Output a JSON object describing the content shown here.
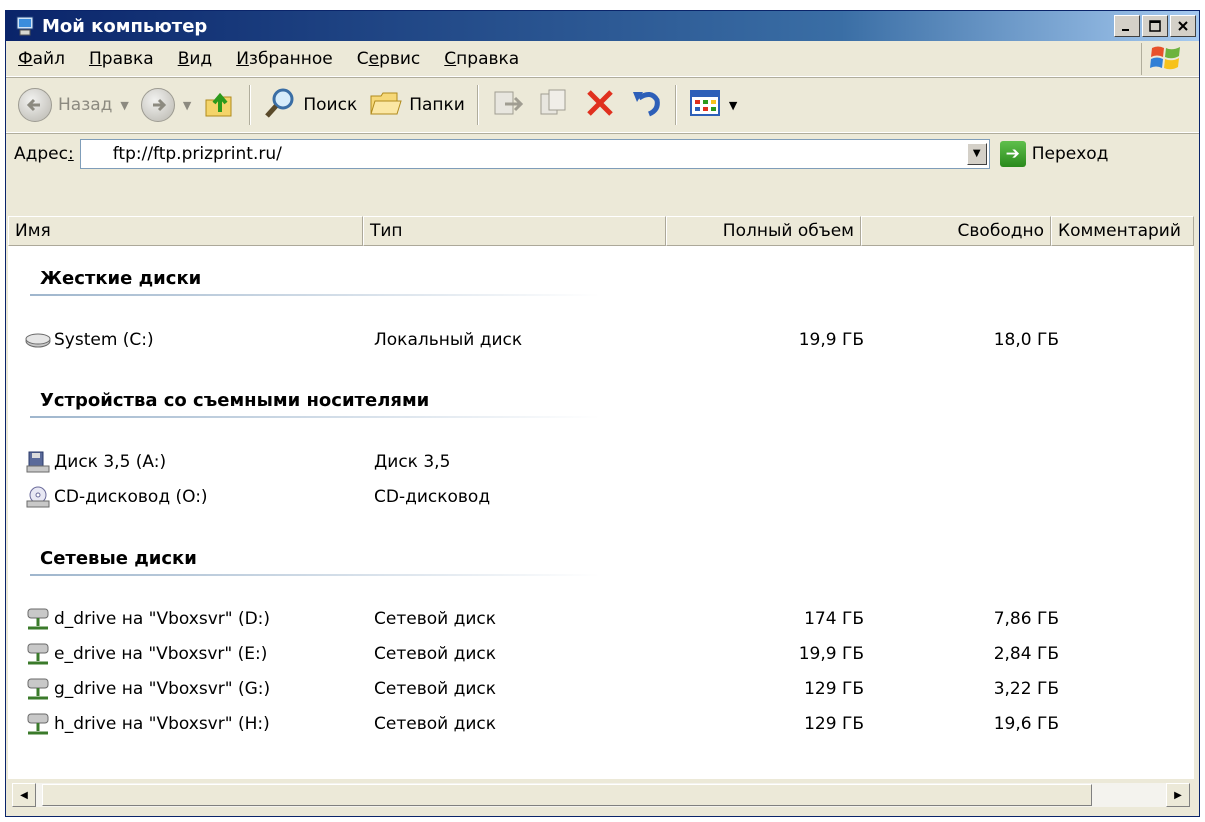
{
  "window": {
    "title": "Мой компьютер"
  },
  "menu": [
    {
      "pre": "",
      "u": "Ф",
      "post": "айл"
    },
    {
      "pre": "",
      "u": "П",
      "post": "равка"
    },
    {
      "pre": "",
      "u": "В",
      "post": "ид"
    },
    {
      "pre": "",
      "u": "И",
      "post": "збранное"
    },
    {
      "pre": "С",
      "u": "е",
      "post": "рвис"
    },
    {
      "pre": "",
      "u": "С",
      "post": "правка"
    }
  ],
  "toolbar": {
    "back_label": "Назад",
    "search_label": "Поиск",
    "folders_label": "Папки"
  },
  "address": {
    "label_pre": "Адрес",
    "label_u": ":",
    "value": "ftp://ftp.prizprint.ru/",
    "go_label": "Переход"
  },
  "columns": {
    "name": "Имя",
    "type": "Тип",
    "total": "Полный объем",
    "free": "Свободно",
    "comment": "Комментарий"
  },
  "groups": {
    "hard": {
      "title": "Жесткие диски",
      "items": [
        {
          "name": "System (C:)",
          "type": "Локальный диск",
          "total": "19,9 ГБ",
          "free": "18,0 ГБ"
        }
      ]
    },
    "removable": {
      "title": "Устройства со съемными носителями",
      "items": [
        {
          "name": "Диск 3,5 (A:)",
          "type": "Диск 3,5",
          "total": "",
          "free": ""
        },
        {
          "name": "CD-дисковод (O:)",
          "type": "CD-дисковод",
          "total": "",
          "free": ""
        }
      ]
    },
    "network": {
      "title": "Сетевые диски",
      "items": [
        {
          "name": "d_drive на \"Vboxsvr\" (D:)",
          "type": "Сетевой диск",
          "total": "174 ГБ",
          "free": "7,86 ГБ"
        },
        {
          "name": "e_drive на \"Vboxsvr\" (E:)",
          "type": "Сетевой диск",
          "total": "19,9 ГБ",
          "free": "2,84 ГБ"
        },
        {
          "name": "g_drive на \"Vboxsvr\" (G:)",
          "type": "Сетевой диск",
          "total": "129 ГБ",
          "free": "3,22 ГБ"
        },
        {
          "name": "h_drive на \"Vboxsvr\" (H:)",
          "type": "Сетевой диск",
          "total": "129 ГБ",
          "free": "19,6 ГБ"
        }
      ]
    }
  }
}
